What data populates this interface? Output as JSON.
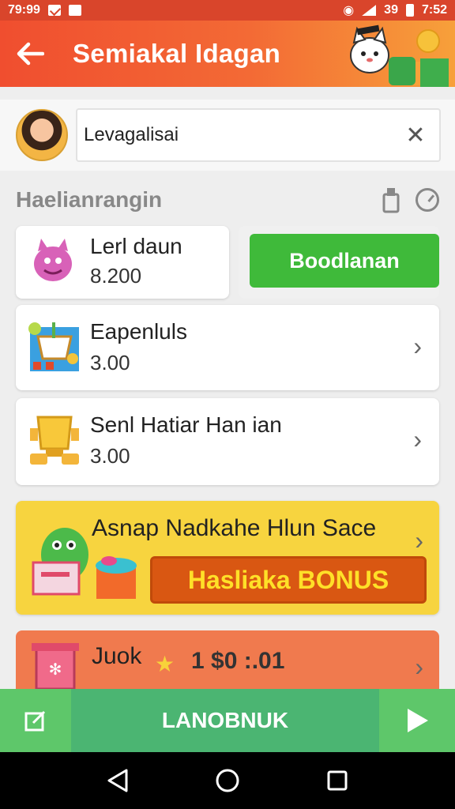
{
  "status_bar": {
    "time_left": "79:99",
    "time_right": "7:52",
    "mid_right": "39"
  },
  "app_bar": {
    "title": "Semiakal Idagan"
  },
  "search": {
    "value": "Levagalisai"
  },
  "section": {
    "title": "Haelianrangin"
  },
  "items": [
    {
      "name": "Lerl daun",
      "price": "8.200"
    },
    {
      "name": "Eapenluls",
      "price": "3.00"
    },
    {
      "name": "Senl Hatiar Han ian",
      "price": "3.00"
    }
  ],
  "buy_button": {
    "label": "Boodlanan"
  },
  "promo": {
    "title": "Asnap Nadkahe Hlun Sace",
    "bonus_label": "Hasliaka BONUS"
  },
  "promo2": {
    "title": "Juok",
    "value": "1 $0 :.01"
  },
  "bottom_bar": {
    "launch_label": "LANOBNUK"
  },
  "colors": {
    "app_bar": "#f04e2f",
    "buy_green": "#3fba3a",
    "promo_yellow": "#f7d43f",
    "bonus_orange": "#d95712",
    "bottom_green": "#5ec76a"
  }
}
